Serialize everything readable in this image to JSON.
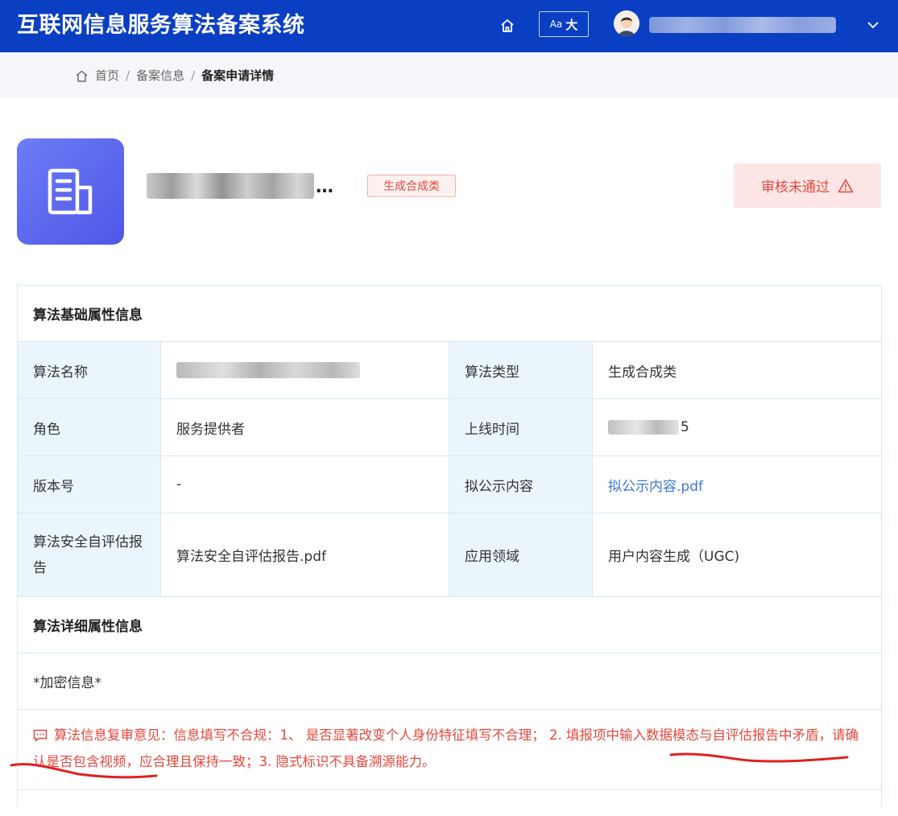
{
  "header": {
    "title": "互联网信息服务算法备案系统",
    "font_size_small": "Aa",
    "font_size_big": "大",
    "brand_color": "#0a3fc4"
  },
  "icons": [
    "home-icon",
    "font-size-icon",
    "avatar-icon",
    "chevron-down-icon",
    "building-icon",
    "warning-icon",
    "comment-icon"
  ],
  "breadcrumb": {
    "items": [
      "首页",
      "备案信息",
      "备案申请详情"
    ],
    "separator": "/"
  },
  "algorithm": {
    "name_suffix": "…",
    "type_tag": "生成合成类",
    "status": "审核未通过",
    "status_color": "#e6483d"
  },
  "basic_info": {
    "section_title": "算法基础属性信息",
    "rows": [
      {
        "label1": "算法名称",
        "label2": "算法类型",
        "value2": "生成合成类"
      },
      {
        "label1": "角色",
        "value1": "服务提供者",
        "label2": "上线时间",
        "value2_tail": "5"
      },
      {
        "label1": "版本号",
        "value1": "-",
        "label2": "拟公示内容",
        "value2": "拟公示内容.pdf"
      },
      {
        "label1": "算法安全自评估报告",
        "value1": "算法安全自评估报告.pdf",
        "label2": "应用领域",
        "value2": "用户内容生成（UGC)"
      }
    ]
  },
  "detail_info": {
    "section_title": "算法详细属性信息",
    "encrypted": "*加密信息*"
  },
  "review": {
    "comment": "算法信息复审意见：信息填写不合规：1、 是否显著改变个人身份特征填写不合理； 2. 填报项中输入数据模态与自评估报告中矛盾，请确认是否包含视频，应合理且保持一致；3. 隐式标识不具备溯源能力。"
  }
}
